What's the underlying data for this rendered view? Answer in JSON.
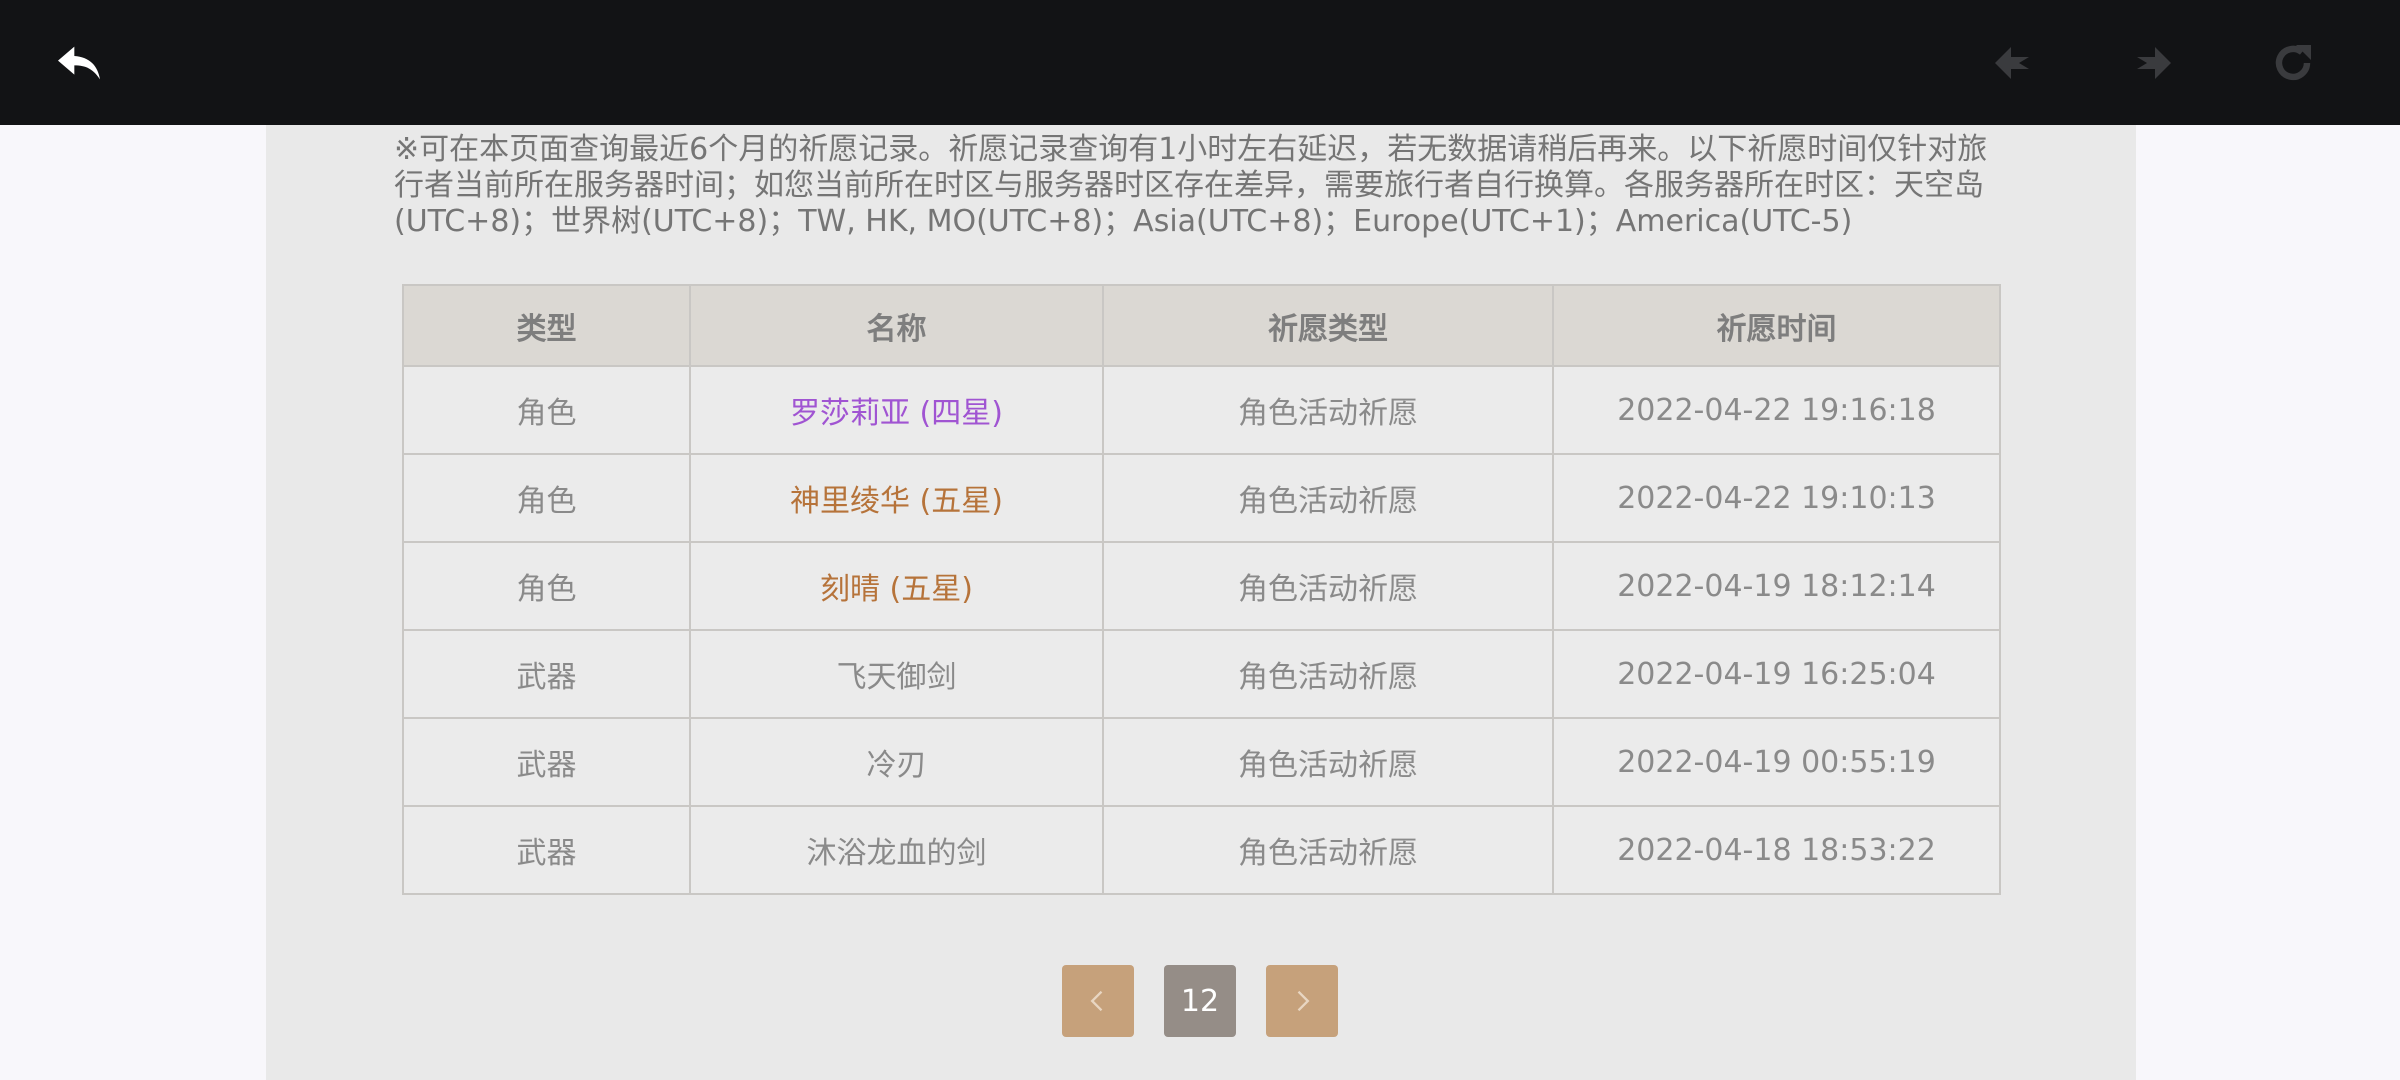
{
  "notice": "※可在本页面查询最近6个月的祈愿记录。祈愿记录查询有1小时左右延迟，若无数据请稍后再来。以下祈愿时间仅针对旅行者当前所在服务器时间；如您当前所在时区与服务器时区存在差异，需要旅行者自行换算。各服务器所在时区：天空岛(UTC+8)；世界树(UTC+8)；TW, HK, MO(UTC+8)；Asia(UTC+8)；Europe(UTC+1)；America(UTC-5)",
  "table": {
    "headers": [
      "类型",
      "名称",
      "祈愿类型",
      "祈愿时间"
    ],
    "rows": [
      {
        "type": "角色",
        "name": "罗莎莉亚 (四星)",
        "wish_type": "角色活动祈愿",
        "time": "2022-04-22 19:16:18",
        "rarity": "four"
      },
      {
        "type": "角色",
        "name": "神里绫华 (五星)",
        "wish_type": "角色活动祈愿",
        "time": "2022-04-22 19:10:13",
        "rarity": "five"
      },
      {
        "type": "角色",
        "name": "刻晴 (五星)",
        "wish_type": "角色活动祈愿",
        "time": "2022-04-19 18:12:14",
        "rarity": "five"
      },
      {
        "type": "武器",
        "name": "飞天御剑",
        "wish_type": "角色活动祈愿",
        "time": "2022-04-19 16:25:04",
        "rarity": "three"
      },
      {
        "type": "武器",
        "name": "冷刃",
        "wish_type": "角色活动祈愿",
        "time": "2022-04-19 00:55:19",
        "rarity": "three"
      },
      {
        "type": "武器",
        "name": "沐浴龙血的剑",
        "wish_type": "角色活动祈愿",
        "time": "2022-04-18 18:53:22",
        "rarity": "three"
      }
    ]
  },
  "pagination": {
    "current_page": "12",
    "prev_icon": "chevron-left-icon",
    "next_icon": "chevron-right-icon"
  },
  "topbar": {
    "back_icon": "back-arrow-icon",
    "prev_icon": "navigate-back-icon",
    "next_icon": "navigate-forward-icon",
    "reload_icon": "reload-icon"
  },
  "colors": {
    "four_star": "#a054d2",
    "five_star": "#b6733a",
    "accent": "#c6a17b"
  }
}
